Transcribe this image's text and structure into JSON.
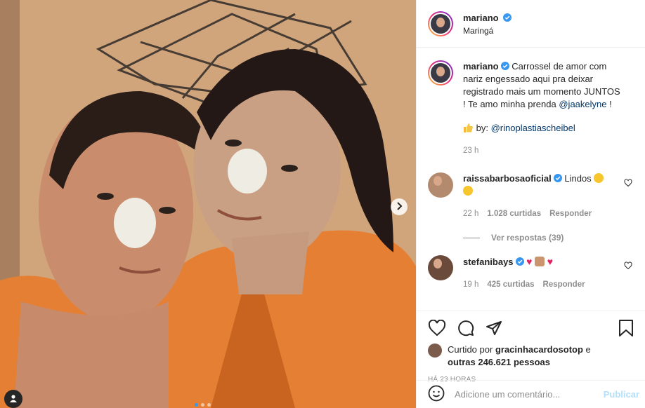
{
  "post": {
    "author": "mariano",
    "location": "Maringá",
    "caption": {
      "author": "mariano",
      "text": "Carrossel de amor com nariz engessado aqui pra deixar registrado mais um momento JUNTOS ! Te amo minha prenda",
      "mention": "@jaakelyne",
      "tail": " !",
      "credit_prefix": "by:",
      "credit_mention": "@rinoplastiascheibel",
      "time": "23 h"
    }
  },
  "comments": [
    {
      "user": "raissabarbosaoficial",
      "text": "Lindos",
      "time": "22 h",
      "likes": "1.028 curtidas",
      "reply": "Responder",
      "view_replies": "Ver respostas (39)"
    },
    {
      "user": "stefanibays",
      "text": "",
      "time": "19 h",
      "likes": "425 curtidas",
      "reply": "Responder"
    }
  ],
  "likes": {
    "prefix": "Curtido por",
    "user": "gracinhacardosotop",
    "conj": " e",
    "others": "outras 246.621 pessoas"
  },
  "timestamp": "HÁ 23 HORAS",
  "add_comment": {
    "placeholder": "Adicione um comentário...",
    "publish": "Publicar"
  },
  "icons": [
    "heart-icon",
    "comment-icon",
    "share-icon",
    "bookmark-icon",
    "verified-icon",
    "chevron-right-icon",
    "user-tag-icon",
    "emoji-icon"
  ],
  "colors": {
    "verified": "#3897f0",
    "link": "#00376b",
    "publish": "#b2dffc",
    "muted": "#8e8e8e"
  }
}
